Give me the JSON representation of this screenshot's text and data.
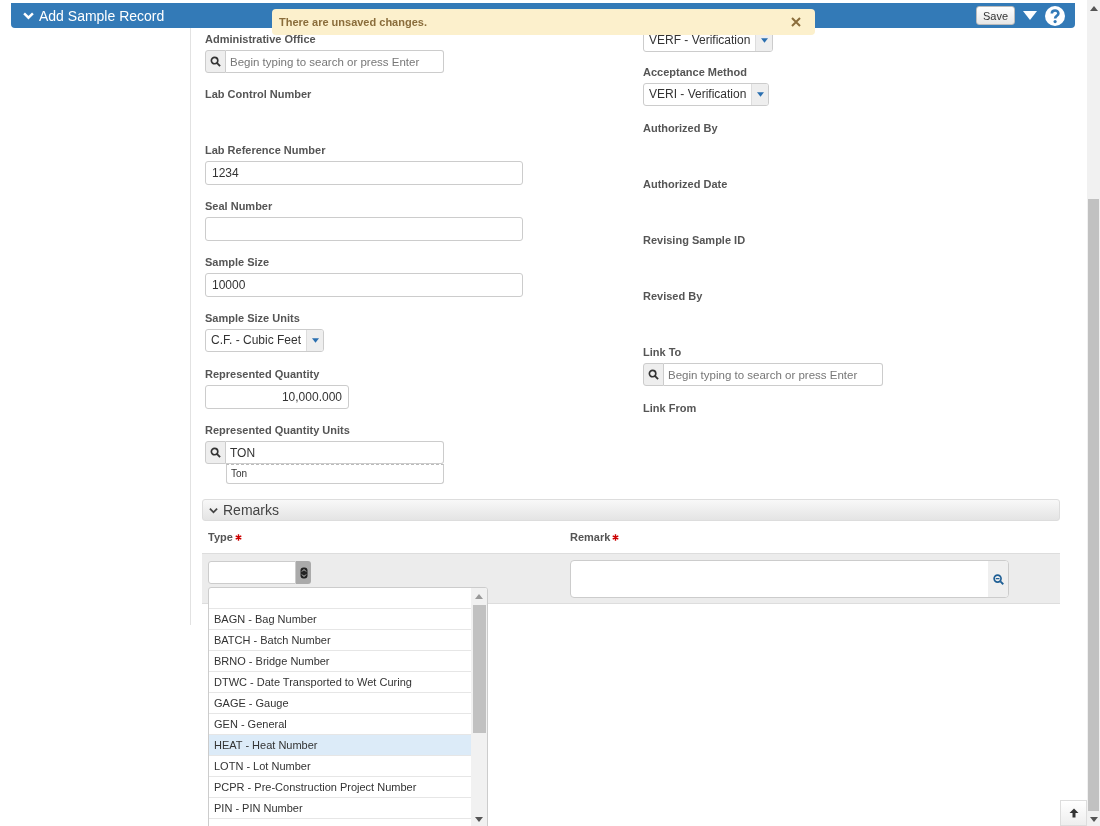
{
  "header": {
    "title": "Add Sample Record",
    "save_label": "Save",
    "expanded": true
  },
  "toast": {
    "message": "There are unsaved changes."
  },
  "left_fields": [
    {
      "kind": "search",
      "label": "Administrative Office",
      "placeholder": "Begin typing to search or press Enter"
    },
    {
      "kind": "readonly",
      "label": "Lab Control Number"
    },
    {
      "kind": "text",
      "label": "Lab Reference Number",
      "value": "1234"
    },
    {
      "kind": "text",
      "label": "Seal Number"
    },
    {
      "kind": "text",
      "label": "Sample Size",
      "value": "10000"
    },
    {
      "kind": "select",
      "label": "Sample Size Units",
      "value": "C.F. - Cubic Feet"
    },
    {
      "kind": "number",
      "label": "Represented Quantity",
      "value": "10,000.000"
    },
    {
      "kind": "search",
      "label": "Represented Quantity Units",
      "value": "TON",
      "suggestions": [
        "Ton"
      ]
    }
  ],
  "right_fields": [
    {
      "kind": "select",
      "value": "VERF - Verification"
    },
    {
      "kind": "select",
      "label": "Acceptance Method",
      "value": "VERI - Verification"
    },
    {
      "kind": "readonly",
      "label": "Authorized By"
    },
    {
      "kind": "readonly",
      "label": "Authorized Date"
    },
    {
      "kind": "readonly",
      "label": "Revising Sample ID"
    },
    {
      "kind": "readonly",
      "label": "Revised By"
    },
    {
      "kind": "search",
      "label": "Link To",
      "placeholder": "Begin typing to search or press Enter"
    },
    {
      "kind": "readonly",
      "label": "Link From"
    }
  ],
  "remarks": {
    "title": "Remarks",
    "expanded": true,
    "columns": [
      {
        "label": "Type",
        "required": true
      },
      {
        "label": "Remark",
        "required": true
      }
    ],
    "type_options": [
      {
        "label": "BAGN - Bag Number",
        "selected": false
      },
      {
        "label": "BATCH - Batch Number",
        "selected": false
      },
      {
        "label": "BRNO - Bridge Number",
        "selected": false
      },
      {
        "label": "DTWC - Date Transported to Wet Curing",
        "selected": false
      },
      {
        "label": "GAGE - Gauge",
        "selected": false
      },
      {
        "label": "GEN - General",
        "selected": false
      },
      {
        "label": "HEAT - Heat Number",
        "selected": true
      },
      {
        "label": "LOTN - Lot Number",
        "selected": false
      },
      {
        "label": "PCPR - Pre-Construction Project Number",
        "selected": false
      },
      {
        "label": "PIN - PIN Number",
        "selected": false
      }
    ]
  }
}
